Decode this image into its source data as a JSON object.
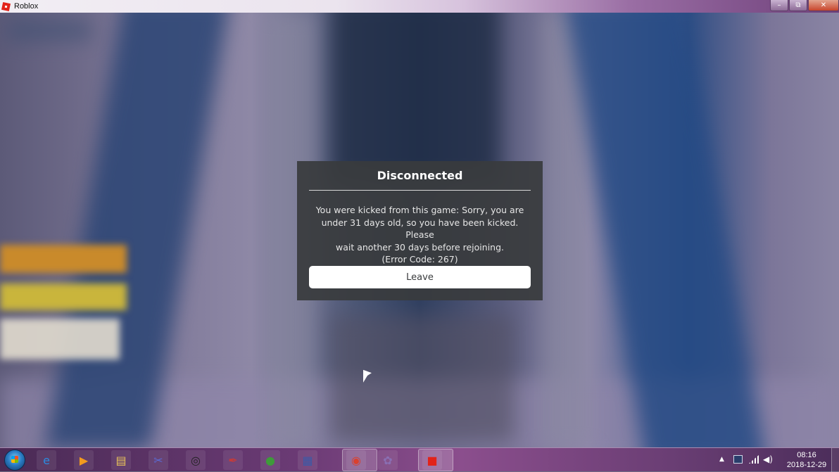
{
  "window": {
    "title": "Roblox",
    "controls": {
      "minimize": "–",
      "restore": "⧉",
      "close": "✕"
    }
  },
  "dialog": {
    "title": "Disconnected",
    "message_line1": "You were kicked from this game: Sorry, you are",
    "message_line2": "under 31 days old, so you have been kicked. Please",
    "message_line3": "wait another 30 days before rejoining.",
    "error_code": "(Error Code: 267)",
    "leave_label": "Leave"
  },
  "taskbar": {
    "pinned": [
      {
        "name": "internet-explorer-icon",
        "glyph": "e",
        "color": "#2b8be0"
      },
      {
        "name": "media-player-icon",
        "glyph": "▶",
        "color": "#f29b1e"
      },
      {
        "name": "file-explorer-icon",
        "glyph": "▤",
        "color": "#e8c35a"
      },
      {
        "name": "snipping-tool-icon",
        "glyph": "✂",
        "color": "#5b6bd6"
      },
      {
        "name": "obs-icon",
        "glyph": "◎",
        "color": "#222222"
      },
      {
        "name": "brush-app-icon",
        "glyph": "✒",
        "color": "#c43b3b"
      },
      {
        "name": "green-globe-app-icon",
        "glyph": "●",
        "color": "#3e9b3a"
      },
      {
        "name": "task-manager-icon",
        "glyph": "▦",
        "color": "#3a5aa8"
      },
      {
        "name": "chrome-icon",
        "glyph": "◉",
        "color": "#d9412f"
      },
      {
        "name": "paint-icon",
        "glyph": "✿",
        "color": "#8a6fb3"
      },
      {
        "name": "roblox-icon",
        "glyph": "■",
        "color": "#e2231a"
      }
    ],
    "tray": {
      "expand_arrow": "▲",
      "volume": "◀)",
      "time": "08:16",
      "date": "2018-12-29"
    }
  }
}
